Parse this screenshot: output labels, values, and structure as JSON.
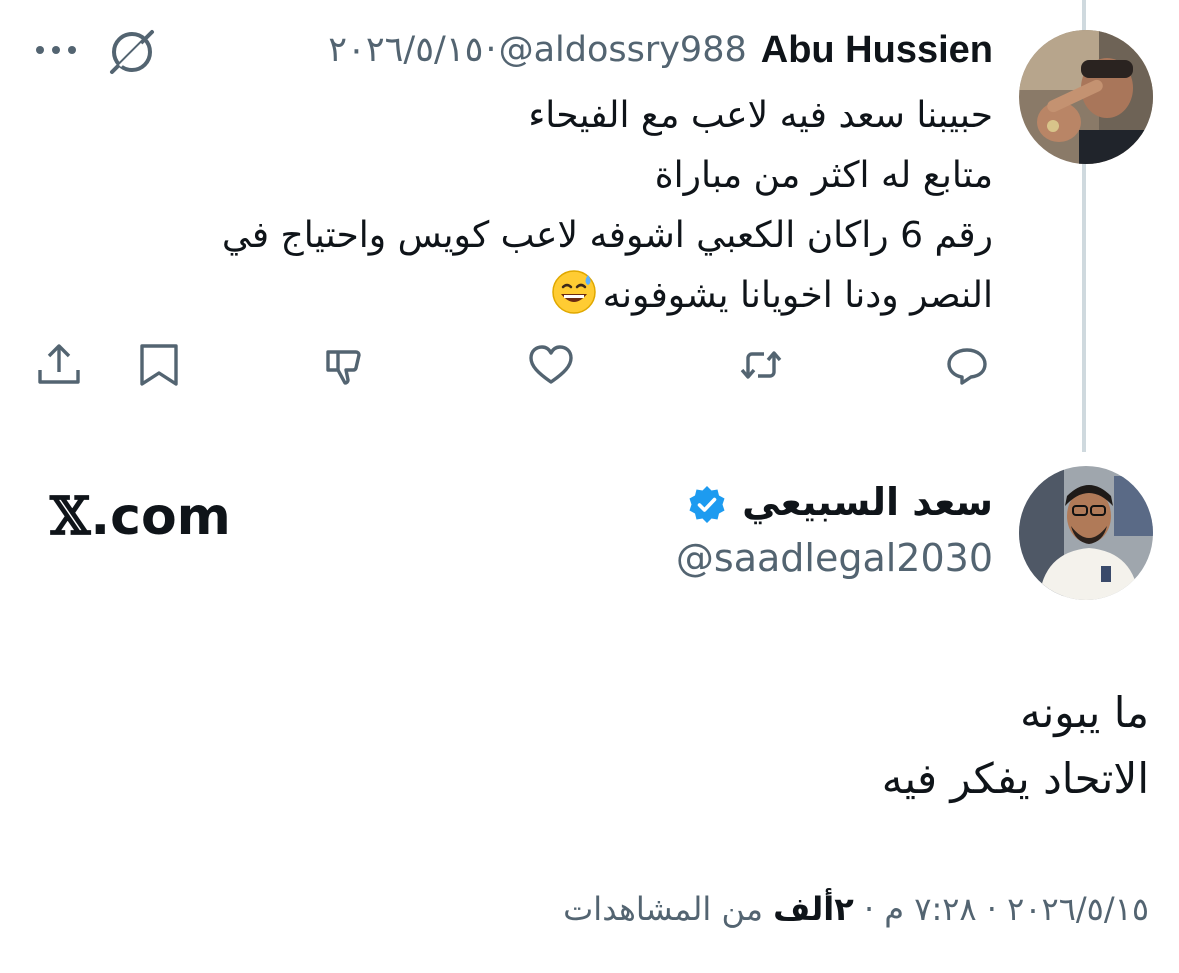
{
  "reply": {
    "display_name": "Abu Hussien",
    "handle": "@aldossry988",
    "separator": "·",
    "date": "٢٠٢٦/٥/١٥",
    "lines": [
      "حبيبنا سعد فيه لاعب مع الفيحاء",
      "متابع له اكثر من مباراة",
      "رقم 6 راكان الكعبي اشوفه لاعب كويس واحتياج في",
      "النصر ودنا اخويانا يشوفونه"
    ],
    "emoji": "sweat-smile-emoji",
    "icons": {
      "more": "more-dots-icon",
      "grok": "grok-icon",
      "reply": "reply-icon",
      "retweet": "retweet-icon",
      "like": "heart-icon",
      "dislike": "thumbs-down-icon",
      "bookmark": "bookmark-icon",
      "share": "share-icon"
    }
  },
  "main_tweet": {
    "display_name": "سعد السبيعي",
    "handle": "@saadlegal2030",
    "verified": true,
    "brand": ".com",
    "brand_glyph": "𝕏",
    "lines": [
      "ما يبونه",
      "الاتحاد يفكر فيه"
    ],
    "meta": {
      "date": "٢٠٢٦/٥/١٥",
      "sep": "·",
      "time": "٧:٢٨ م",
      "views_count": "٢ألف",
      "views_label": "من المشاهدات"
    }
  },
  "colors": {
    "text": "#0f1419",
    "secondary": "#536471",
    "verified_blue": "#1d9bf0",
    "thread_line": "#cfd9de"
  }
}
